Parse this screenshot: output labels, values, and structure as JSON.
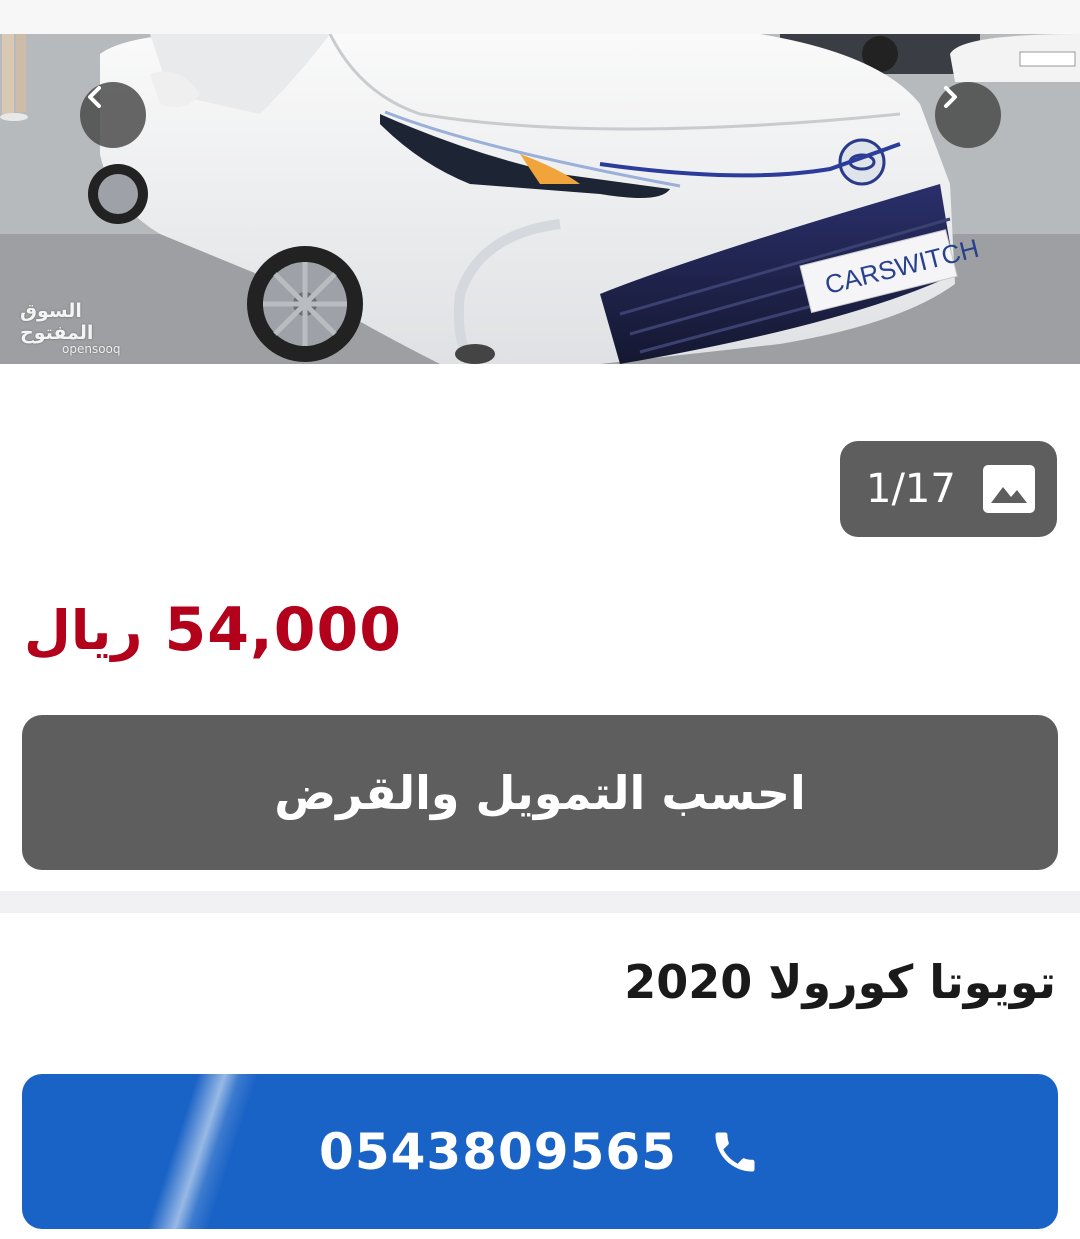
{
  "gallery": {
    "watermark_arabic": "السوق المفتوح",
    "watermark_latin": "opensooq",
    "plate_text": "CARSWITCH",
    "counter_text": "1/17",
    "icons": {
      "prev": "chevron-left-icon",
      "next": "chevron-right-icon",
      "gallery": "image-icon"
    }
  },
  "listing": {
    "price_value": "54,000",
    "price_currency": "ريال",
    "title": "تويوتا كورولا 2020"
  },
  "actions": {
    "finance_label": "احسب التمويل والقرض",
    "phone_number": "0543809565",
    "phone_icon": "phone-icon"
  },
  "colors": {
    "price": "#b3001b",
    "finance_button": "#5e5e5e",
    "call_button": "#1a63c6"
  }
}
